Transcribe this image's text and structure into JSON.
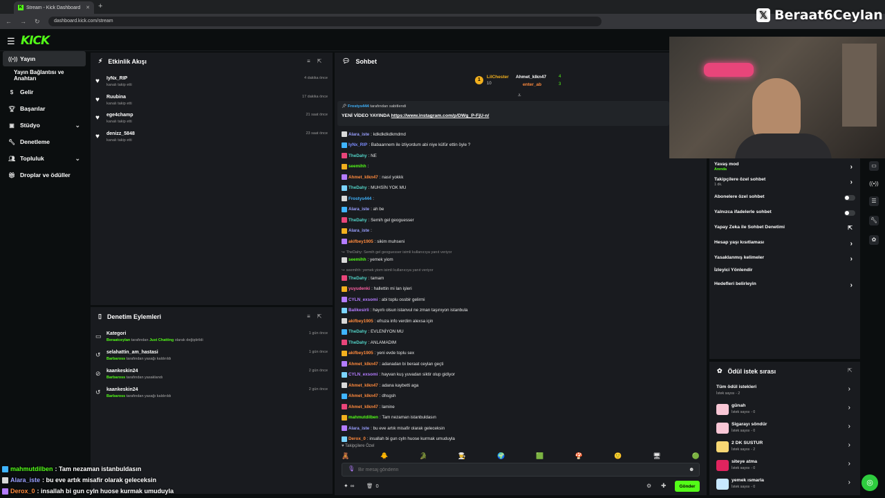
{
  "browser": {
    "tab_title": "Stream - Kick Dashboard",
    "url": "dashboard.kick.com/stream"
  },
  "overlay": {
    "handle": "Beraat6Ceylan"
  },
  "brand": {
    "logo": "KICK",
    "accent": "#53fc18"
  },
  "sidebar": {
    "items": [
      {
        "label": "Yayın",
        "icon": "broadcast-icon"
      },
      {
        "label": "Yayın Bağlantısı ve Anahtarı",
        "icon": ""
      },
      {
        "label": "Gelir",
        "icon": "dollar-icon"
      },
      {
        "label": "Başarılar",
        "icon": "trophy-icon"
      },
      {
        "label": "Stüdyo",
        "icon": "studio-icon"
      },
      {
        "label": "Denetleme",
        "icon": "wrench-icon"
      },
      {
        "label": "Topluluk",
        "icon": "users-icon"
      },
      {
        "label": "Droplar ve ödüller",
        "icon": "gift-icon"
      }
    ]
  },
  "activity": {
    "title": "Etkinlik Akışı",
    "events": [
      {
        "name": "IyNx_RIP",
        "sub": "kanalı takip etti",
        "time": "4 dakika önce"
      },
      {
        "name": "Ruubina",
        "sub": "kanalı takip etti",
        "time": "17 dakika önce"
      },
      {
        "name": "ege4champ",
        "sub": "kanalı takip etti",
        "time": "21 saat önce"
      },
      {
        "name": "denizz_5848",
        "sub": "kanalı takip etti",
        "time": "23 saat önce"
      }
    ]
  },
  "moderation": {
    "title": "Denetim Eylemleri",
    "items": [
      {
        "name": "Kategori",
        "actor": "Beraatceylan",
        "mid": " tarafından ",
        "target": "Just Chatting",
        "tail": " olarak değiştirildi",
        "time": "1 gün önce"
      },
      {
        "name": "selahattin_am_hastasi",
        "actor": "Barbaross",
        "mid": " tarafından yasağı kaldırıldı",
        "target": "",
        "tail": "",
        "time": "1 gün önce"
      },
      {
        "name": "kaankeskin24",
        "actor": "Barbaross",
        "mid": " tarafından yasaklandı",
        "target": "",
        "tail": "",
        "time": "2 gün önce"
      },
      {
        "name": "kaankeskin24",
        "actor": "Barbaross",
        "mid": " tarafından yasağı kaldırıldı",
        "target": "",
        "tail": "",
        "time": "2 gün önce"
      }
    ]
  },
  "chat": {
    "title": "Sohbet",
    "top_gifters": [
      {
        "name": "LilChester",
        "count": "10"
      },
      {
        "name": "Ahmet_klkn47",
        "count": "4"
      },
      {
        "name": "enter_ab",
        "count": "3"
      }
    ],
    "pinned": {
      "by_user": "Frostys444",
      "by_text": " tarafından sabitlendi",
      "text": "YENİ VİDEO YAYINDA ",
      "link": "https://www.instagram.com/p/DWg_P-FjU-n/"
    },
    "messages": [
      {
        "user": "Alara_iste",
        "color": "#9aa0ff",
        "text": ": kdkdkdkdkmdmd",
        "type": "msg"
      },
      {
        "user": "IyNx_RIP",
        "color": "#7b8cff",
        "text": ": Babaannem ile izliyordum abi niye küfür ettin öyle ?",
        "type": "msg"
      },
      {
        "user": "TheDahy",
        "color": "#53d4c8",
        "text": ": NE",
        "type": "msg"
      },
      {
        "user": "seemihh",
        "color": "#53fc18",
        "text": ": ",
        "type": "msg"
      },
      {
        "user": "Ahmet_klkn47",
        "color": "#ff8a3d",
        "text": ": nasıl yokkk",
        "type": "msg"
      },
      {
        "user": "TheDahy",
        "color": "#53d4c8",
        "text": ": MUHSİN YOK MU",
        "type": "msg"
      },
      {
        "user": "Frostys444",
        "color": "#3fb4ff",
        "text": ": ",
        "type": "msg"
      },
      {
        "user": "Alara_iste",
        "color": "#9aa0ff",
        "text": ": ah be",
        "type": "msg"
      },
      {
        "user": "TheDahy",
        "color": "#53d4c8",
        "text": ": Semih gel geoguesser",
        "type": "msg"
      },
      {
        "user": "Alara_iste",
        "color": "#9aa0ff",
        "text": ": ",
        "type": "msg"
      },
      {
        "user": "akifbey1905",
        "color": "#ff8a3d",
        "text": ": sikim muhseni",
        "type": "msg"
      },
      {
        "user": "",
        "color": "#888",
        "text": "TheDahy: Semih gel geoguesser isimli kullanıcıya yanıt veriyor",
        "type": "reply"
      },
      {
        "user": "seemihh",
        "color": "#53fc18",
        "text": ": yemek yiom",
        "type": "msg"
      },
      {
        "user": "",
        "color": "#888",
        "text": "seemihh: yemek yiom isimli kullanıcıya yanıt veriyor",
        "type": "reply"
      },
      {
        "user": "TheDahy",
        "color": "#53d4c8",
        "text": ": tamam",
        "type": "msg"
      },
      {
        "user": "yuyudenki",
        "color": "#ff5fa2",
        "text": ": hallettin mi lan işleri",
        "type": "msg"
      },
      {
        "user": "CYLN_exsomi",
        "color": "#b47cff",
        "text": ": abi toplu ossbir gelirmi",
        "type": "msg"
      },
      {
        "user": "Balikesirli",
        "color": "#b47cff",
        "text": ": hayırlı olsun istanvul ne zman taşınıyon istanbula",
        "type": "msg"
      },
      {
        "user": "akifbey1905",
        "color": "#ff8a3d",
        "text": ": efruza info verdim alexsa için",
        "type": "msg"
      },
      {
        "user": "TheDahy",
        "color": "#53d4c8",
        "text": ": EVLENİYON MU",
        "type": "msg"
      },
      {
        "user": "TheDahy",
        "color": "#53d4c8",
        "text": ": ANLAMADIM",
        "type": "msg"
      },
      {
        "user": "akifbey1905",
        "color": "#ff8a3d",
        "text": ": yeni evde toplu sex",
        "type": "msg"
      },
      {
        "user": "Ahmet_klkn47",
        "color": "#ff8a3d",
        "text": ": adanadan bi beraat ceylan geçti",
        "type": "msg"
      },
      {
        "user": "CYLN_exsomi",
        "color": "#b47cff",
        "text": ": hayvan kuş yuvadan siktir olup gidiyor",
        "type": "msg"
      },
      {
        "user": "Ahmet_klkn47",
        "color": "#ff8a3d",
        "text": ": adana kaybetti aga",
        "type": "msg"
      },
      {
        "user": "Ahmet_klkn47",
        "color": "#ff8a3d",
        "text": ": dhsgsh",
        "type": "msg"
      },
      {
        "user": "Ahmet_klkn47",
        "color": "#ff8a3d",
        "text": ": lamine",
        "type": "msg"
      },
      {
        "user": "mahmutdilben",
        "color": "#53fc18",
        "text": ": Tam nezaman istanbuldasın",
        "type": "msg"
      },
      {
        "user": "Alara_iste",
        "color": "#9aa0ff",
        "text": ": bu eve artık misafir olarak geleceksin",
        "type": "msg"
      },
      {
        "user": "Derox_0",
        "color": "#ff8a3d",
        "text": ": insallah bi gun cyln huose kurmak umuduyla",
        "type": "msg"
      }
    ],
    "followers_only": "Takipçilere Özel",
    "input_placeholder": "Bir mesaj gönderin",
    "points": "∞",
    "bag_count": "0",
    "send_label": "Gönder"
  },
  "settings": {
    "items": [
      {
        "label": "Yavaş mod",
        "sub": "Anında",
        "sub_green": true,
        "control": "chevron"
      },
      {
        "label": "Takipçilere özel sohbet",
        "sub": "1 dk.",
        "sub_green": false,
        "control": "chevron"
      },
      {
        "label": "Abonelere özel sohbet",
        "sub": "",
        "sub_green": false,
        "control": "toggle"
      },
      {
        "label": "Yalnızca ifadelerle sohbet",
        "sub": "",
        "sub_green": false,
        "control": "toggle"
      },
      {
        "label": "Yapay Zeka ile Sohbet Denetimi",
        "sub": "",
        "sub_green": false,
        "control": "external"
      },
      {
        "label": "Hesap yaşı kısıtlaması",
        "sub": "",
        "sub_green": false,
        "control": "chevron"
      },
      {
        "label": "Yasaklanmış kelimeler",
        "sub": "",
        "sub_green": false,
        "control": "chevron"
      },
      {
        "label": "İzleyici Yönlendir",
        "sub": "",
        "sub_green": false,
        "control": "none"
      },
      {
        "label": "Hedefleri belirleyin",
        "sub": "",
        "sub_green": false,
        "control": "chevron"
      }
    ]
  },
  "rewards": {
    "title": "Ödül istek sırası",
    "items": [
      {
        "name": "Tüm ödül istekleri",
        "sub": "İstek sayısı - 2",
        "icon": "",
        "dot": true
      },
      {
        "name": "günah",
        "sub": "İstek sayısı - 0",
        "icon": "#f9c7d6",
        "dot": false
      },
      {
        "name": "Sigarayı söndür",
        "sub": "İstek sayısı - 0",
        "icon": "#f9c7d6",
        "dot": false
      },
      {
        "name": "2 DK SUSTUR",
        "sub": "İstek sayısı - 2",
        "icon": "#f7d774",
        "dot": true
      },
      {
        "name": "siteye atma",
        "sub": "İstek sayısı - 0",
        "icon": "#e0245e",
        "dot": false
      },
      {
        "name": "yemek ısmarla",
        "sub": "İstek sayısı - 0",
        "icon": "#c7e7ff",
        "dot": false
      }
    ]
  },
  "stream_overlay": [
    {
      "user": "mahmutdilben",
      "color": "#53fc18",
      "text": ": Tam nezaman istanbuldasın"
    },
    {
      "user": "Alara_iste",
      "color": "#9aa0ff",
      "text": ": bu eve artık misafir olarak geleceksin"
    },
    {
      "user": "Derox_0",
      "color": "#ff8a3d",
      "text": ": insallah bi gun cyln huose kurmak umuduyla"
    }
  ]
}
